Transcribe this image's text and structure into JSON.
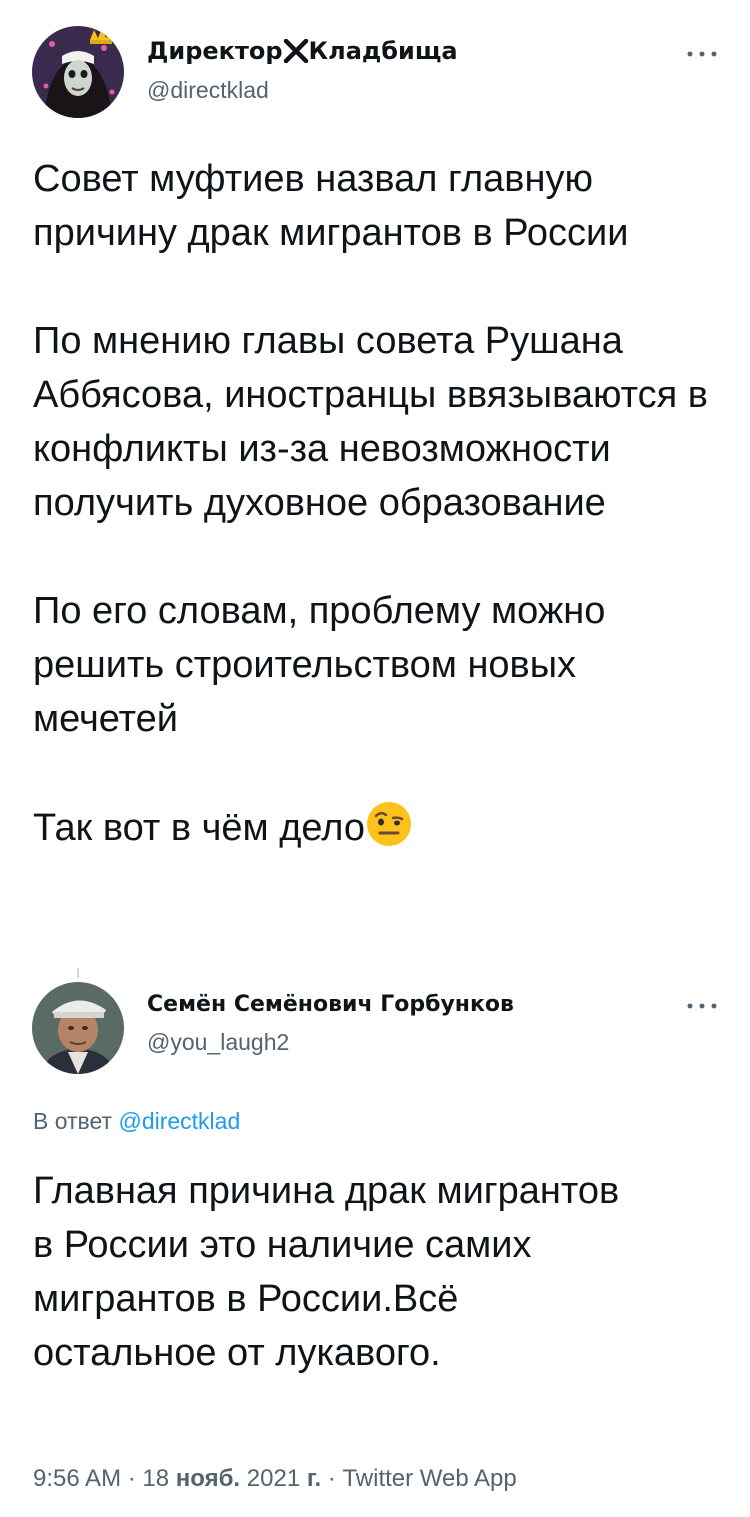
{
  "tweet1": {
    "display_name_part1": "Директор",
    "display_name_part2": "Кладбища",
    "handle": "@directklad",
    "paragraphs": [
      "Совет муфтиев назвал главную причину драк мигрантов в России",
      "По мнению главы совета Рушана Аббясова, иностранцы ввязываются в конфликты из-за невозможности получить духовное образование",
      "По его словам, проблему можно решить строительством новых мечетей",
      "Так вот в чём дело"
    ],
    "separator_icon": "x-cross-icon",
    "avatar_icon": "nun-avatar",
    "emoji_icon": "face-with-raised-eyebrow-emoji"
  },
  "tweet2": {
    "display_name": "Семён Семёнович Горбунков",
    "handle": "@you_laugh2",
    "reply_prefix": "В ответ",
    "reply_handle": "@directklad",
    "text": "Главная причина драк мигрантов в России это наличие самих мигрантов в России.Всё остальное от лукавого.",
    "avatar_icon": "man-in-cap-avatar"
  },
  "meta": {
    "time": "9:56 AM",
    "sep1": " · ",
    "date_day": "18 ",
    "date_month": "нояб.",
    "date_year": " 2021 ",
    "date_suffix": "г.",
    "sep2": " · ",
    "source": "Twitter Web App"
  },
  "colors": {
    "text": "#0f1419",
    "secondary": "#536471",
    "link": "#1d9bf0"
  }
}
